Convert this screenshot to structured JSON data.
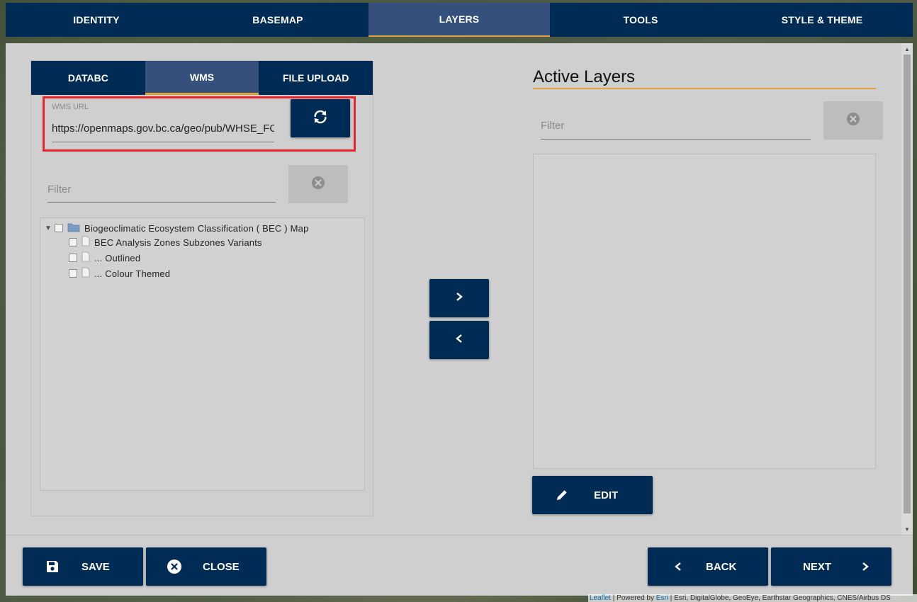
{
  "top_tabs": [
    {
      "label": "IDENTITY"
    },
    {
      "label": "BASEMAP"
    },
    {
      "label": "LAYERS"
    },
    {
      "label": "TOOLS"
    },
    {
      "label": "STYLE & THEME"
    }
  ],
  "active_top_tab": "LAYERS",
  "source_tabs": [
    {
      "label": "DATABC"
    },
    {
      "label": "WMS"
    },
    {
      "label": "FILE UPLOAD"
    }
  ],
  "active_source_tab": "WMS",
  "wms": {
    "label": "WMS URL",
    "url": "https://openmaps.gov.bc.ca/geo/pub/WHSE_FO"
  },
  "left_filter": {
    "placeholder": "Filter"
  },
  "tree": {
    "root_label": "Biogeoclimatic Ecosystem Classification ( BEC ) Map",
    "children": [
      {
        "label": "BEC Analysis Zones Subzones Variants"
      },
      {
        "label": "... Outlined"
      },
      {
        "label": "... Colour Themed"
      }
    ]
  },
  "active_layers": {
    "title": "Active Layers",
    "filter_placeholder": "Filter",
    "edit_label": "EDIT"
  },
  "footer": {
    "save_label": "SAVE",
    "close_label": "CLOSE",
    "back_label": "BACK",
    "next_label": "NEXT"
  },
  "attribution": {
    "leaflet": "Leaflet",
    "powered_by": " | Powered by ",
    "esri": "Esri",
    "credits": " | Esri, DigitalGlobe, GeoEye, Earthstar Geographics, CNES/Airbus DS"
  },
  "colors": {
    "primary": "#002b55",
    "active_tab": "#35507a",
    "accent": "#e1a53d",
    "highlight_border": "#e8232a",
    "panel_bg": "#cfcfcf"
  }
}
